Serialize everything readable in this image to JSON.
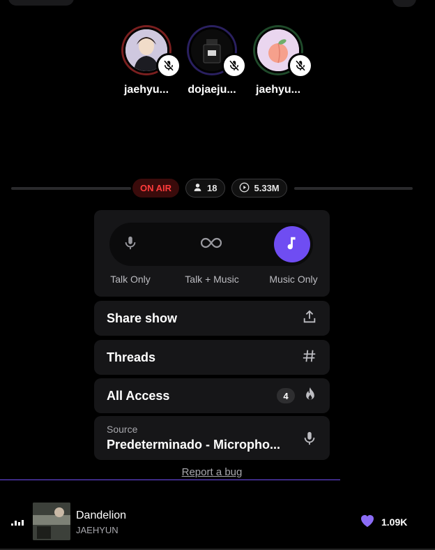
{
  "speakers": [
    {
      "name": "jaehyu...",
      "ring_color": "#7a1f1f",
      "avatar": "portrait-avatar",
      "muted": true
    },
    {
      "name": "dojaeju...",
      "ring_color": "#2a2060",
      "avatar": "bottle-avatar",
      "muted": true
    },
    {
      "name": "jaehyu...",
      "ring_color": "#1f4a2a",
      "avatar": "peach-avatar",
      "muted": true
    }
  ],
  "status": {
    "on_air": "ON AIR",
    "listeners": "18",
    "plays": "5.33M"
  },
  "modes": {
    "items": [
      {
        "label": "Talk Only",
        "icon": "microphone-icon",
        "active": false
      },
      {
        "label": "Talk + Music",
        "icon": "infinity-icon",
        "active": false
      },
      {
        "label": "Music Only",
        "icon": "music-note-icon",
        "active": true
      }
    ],
    "accent": "#6f4df2"
  },
  "menu": {
    "share": {
      "label": "Share show",
      "icon": "upload-icon"
    },
    "threads": {
      "label": "Threads",
      "icon": "hashtag-icon"
    },
    "all_access": {
      "label": "All Access",
      "count": "4",
      "icon": "flame-icon"
    }
  },
  "source": {
    "label": "Source",
    "value": "Predeterminado - Micropho..."
  },
  "report_bug": "Report a bug",
  "now_playing": {
    "title": "Dandelion",
    "artist": "JAEHYUN",
    "likes": "1.09K",
    "progress": 0.78
  }
}
